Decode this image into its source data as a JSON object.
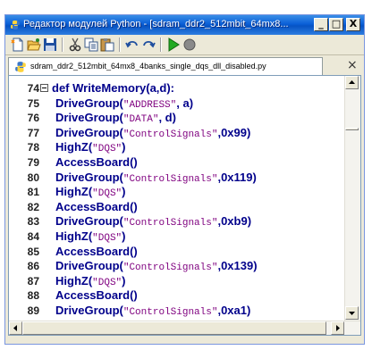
{
  "window": {
    "title": "Редактор модулей Python - [sdram_ddr2_512mbit_64mx8...",
    "minimize": "_",
    "maximize": "□",
    "close": "X"
  },
  "tab": {
    "label": "sdram_ddr2_512mbit_64mx8_4banks_single_dqs_dll_disabled.py",
    "close": "×"
  },
  "editor": {
    "lines": [
      {
        "n": "74",
        "code": [
          {
            "t": "def ",
            "c": "kw"
          },
          {
            "t": "WriteMemory(a,d):",
            "c": "fn"
          }
        ]
      },
      {
        "n": "75",
        "code": [
          {
            "t": "DriveGroup(",
            "c": "fn"
          },
          {
            "t": "\"ADDRESS\"",
            "c": "str"
          },
          {
            "t": ", a)",
            "c": "fn"
          }
        ]
      },
      {
        "n": "76",
        "code": [
          {
            "t": "DriveGroup(",
            "c": "fn"
          },
          {
            "t": "\"DATA\"",
            "c": "str"
          },
          {
            "t": ", d)",
            "c": "fn"
          }
        ]
      },
      {
        "n": "77",
        "code": [
          {
            "t": "DriveGroup(",
            "c": "fn"
          },
          {
            "t": "\"ControlSignals\"",
            "c": "str"
          },
          {
            "t": ",0x99)",
            "c": "fn"
          }
        ]
      },
      {
        "n": "78",
        "code": [
          {
            "t": "HighZ(",
            "c": "fn"
          },
          {
            "t": "\"DQS\"",
            "c": "str"
          },
          {
            "t": ")",
            "c": "fn"
          }
        ]
      },
      {
        "n": "79",
        "code": [
          {
            "t": "AccessBoard()",
            "c": "fn"
          }
        ]
      },
      {
        "n": "80",
        "code": [
          {
            "t": "DriveGroup(",
            "c": "fn"
          },
          {
            "t": "\"ControlSignals\"",
            "c": "str"
          },
          {
            "t": ",0x119)",
            "c": "fn"
          }
        ]
      },
      {
        "n": "81",
        "code": [
          {
            "t": "HighZ(",
            "c": "fn"
          },
          {
            "t": "\"DQS\"",
            "c": "str"
          },
          {
            "t": ")",
            "c": "fn"
          }
        ]
      },
      {
        "n": "82",
        "code": [
          {
            "t": "AccessBoard()",
            "c": "fn"
          }
        ]
      },
      {
        "n": "83",
        "code": [
          {
            "t": "DriveGroup(",
            "c": "fn"
          },
          {
            "t": "\"ControlSignals\"",
            "c": "str"
          },
          {
            "t": ",0xb9)",
            "c": "fn"
          }
        ]
      },
      {
        "n": "84",
        "code": [
          {
            "t": "HighZ(",
            "c": "fn"
          },
          {
            "t": "\"DQS\"",
            "c": "str"
          },
          {
            "t": ")",
            "c": "fn"
          }
        ]
      },
      {
        "n": "85",
        "code": [
          {
            "t": "AccessBoard()",
            "c": "fn"
          }
        ]
      },
      {
        "n": "86",
        "code": [
          {
            "t": "DriveGroup(",
            "c": "fn"
          },
          {
            "t": "\"ControlSignals\"",
            "c": "str"
          },
          {
            "t": ",0x139)",
            "c": "fn"
          }
        ]
      },
      {
        "n": "87",
        "code": [
          {
            "t": "HighZ(",
            "c": "fn"
          },
          {
            "t": "\"DQS\"",
            "c": "str"
          },
          {
            "t": ")",
            "c": "fn"
          }
        ]
      },
      {
        "n": "88",
        "code": [
          {
            "t": "AccessBoard()",
            "c": "fn"
          }
        ]
      },
      {
        "n": "89",
        "code": [
          {
            "t": "DriveGroup(",
            "c": "fn"
          },
          {
            "t": "\"ControlSignals\"",
            "c": "str"
          },
          {
            "t": ",0xa1)",
            "c": "fn"
          }
        ]
      }
    ]
  },
  "toolbar": {
    "icons": [
      "new-file-icon",
      "open-folder-icon",
      "save-icon",
      "cut-icon",
      "copy-icon",
      "paste-icon",
      "undo-icon",
      "redo-icon",
      "run-icon",
      "stop-icon"
    ]
  },
  "colors": {
    "titlebar": "#0a5fd8",
    "keyword": "#00008b",
    "string": "#7f007f",
    "run": "#22aa22",
    "stop": "#808080"
  }
}
